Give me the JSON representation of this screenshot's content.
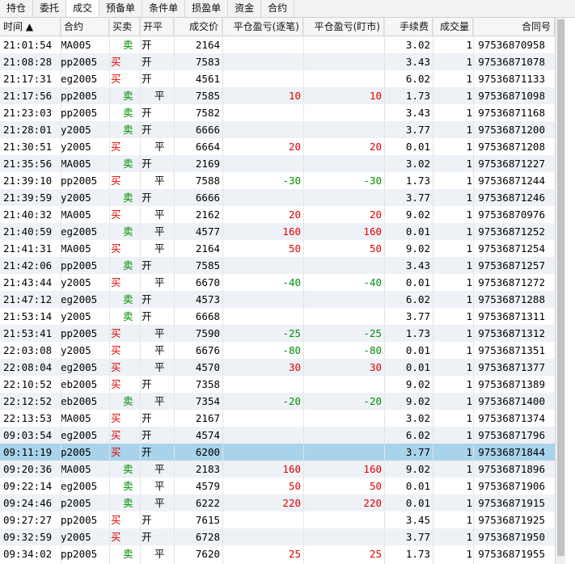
{
  "tabs": [
    "持仓",
    "委托",
    "成交",
    "预备单",
    "条件单",
    "损盈单",
    "资金",
    "合约"
  ],
  "active_tab": "成交",
  "columns": [
    "时间 ▲",
    "合约",
    "买卖",
    "开平",
    "成交价",
    "平仓盈亏(逐笔)",
    "平仓盈亏(盯市)",
    "手续费",
    "成交量",
    "合同号"
  ],
  "colors": {
    "buy": "#e00000",
    "sell": "#009000",
    "selected": "#a9d3ea"
  },
  "rows": [
    {
      "time": "21:01:54",
      "contract": "MA005",
      "side": "卖",
      "oc": "开",
      "price": "2164",
      "pnl1": "",
      "pnl2": "",
      "fee": "3.02",
      "qty": "1",
      "order": "97536870958"
    },
    {
      "time": "21:08:28",
      "contract": "pp2005",
      "side": "买",
      "oc": "开",
      "price": "7583",
      "pnl1": "",
      "pnl2": "",
      "fee": "3.43",
      "qty": "1",
      "order": "97536871078"
    },
    {
      "time": "21:17:31",
      "contract": "eg2005",
      "side": "买",
      "oc": "开",
      "price": "4561",
      "pnl1": "",
      "pnl2": "",
      "fee": "6.02",
      "qty": "1",
      "order": "97536871133"
    },
    {
      "time": "21:17:56",
      "contract": "pp2005",
      "side": "卖",
      "oc": "平",
      "price": "7585",
      "pnl1": "10",
      "pnl2": "10",
      "fee": "1.73",
      "qty": "1",
      "order": "97536871098"
    },
    {
      "time": "21:23:03",
      "contract": "pp2005",
      "side": "卖",
      "oc": "开",
      "price": "7582",
      "pnl1": "",
      "pnl2": "",
      "fee": "3.43",
      "qty": "1",
      "order": "97536871168"
    },
    {
      "time": "21:28:01",
      "contract": "y2005",
      "side": "卖",
      "oc": "开",
      "price": "6666",
      "pnl1": "",
      "pnl2": "",
      "fee": "3.77",
      "qty": "1",
      "order": "97536871200"
    },
    {
      "time": "21:30:51",
      "contract": "y2005",
      "side": "买",
      "oc": "平",
      "price": "6664",
      "pnl1": "20",
      "pnl2": "20",
      "fee": "0.01",
      "qty": "1",
      "order": "97536871208"
    },
    {
      "time": "21:35:56",
      "contract": "MA005",
      "side": "卖",
      "oc": "开",
      "price": "2169",
      "pnl1": "",
      "pnl2": "",
      "fee": "3.02",
      "qty": "1",
      "order": "97536871227"
    },
    {
      "time": "21:39:10",
      "contract": "pp2005",
      "side": "买",
      "oc": "平",
      "price": "7588",
      "pnl1": "-30",
      "pnl2": "-30",
      "fee": "1.73",
      "qty": "1",
      "order": "97536871244"
    },
    {
      "time": "21:39:59",
      "contract": "y2005",
      "side": "卖",
      "oc": "开",
      "price": "6666",
      "pnl1": "",
      "pnl2": "",
      "fee": "3.77",
      "qty": "1",
      "order": "97536871246"
    },
    {
      "time": "21:40:32",
      "contract": "MA005",
      "side": "买",
      "oc": "平",
      "price": "2162",
      "pnl1": "20",
      "pnl2": "20",
      "fee": "9.02",
      "qty": "1",
      "order": "97536870976"
    },
    {
      "time": "21:40:59",
      "contract": "eg2005",
      "side": "卖",
      "oc": "平",
      "price": "4577",
      "pnl1": "160",
      "pnl2": "160",
      "fee": "0.01",
      "qty": "1",
      "order": "97536871252"
    },
    {
      "time": "21:41:31",
      "contract": "MA005",
      "side": "买",
      "oc": "平",
      "price": "2164",
      "pnl1": "50",
      "pnl2": "50",
      "fee": "9.02",
      "qty": "1",
      "order": "97536871254"
    },
    {
      "time": "21:42:06",
      "contract": "pp2005",
      "side": "卖",
      "oc": "开",
      "price": "7585",
      "pnl1": "",
      "pnl2": "",
      "fee": "3.43",
      "qty": "1",
      "order": "97536871257"
    },
    {
      "time": "21:43:44",
      "contract": "y2005",
      "side": "买",
      "oc": "平",
      "price": "6670",
      "pnl1": "-40",
      "pnl2": "-40",
      "fee": "0.01",
      "qty": "1",
      "order": "97536871272"
    },
    {
      "time": "21:47:12",
      "contract": "eg2005",
      "side": "卖",
      "oc": "开",
      "price": "4573",
      "pnl1": "",
      "pnl2": "",
      "fee": "6.02",
      "qty": "1",
      "order": "97536871288"
    },
    {
      "time": "21:53:14",
      "contract": "y2005",
      "side": "卖",
      "oc": "开",
      "price": "6668",
      "pnl1": "",
      "pnl2": "",
      "fee": "3.77",
      "qty": "1",
      "order": "97536871311"
    },
    {
      "time": "21:53:41",
      "contract": "pp2005",
      "side": "买",
      "oc": "平",
      "price": "7590",
      "pnl1": "-25",
      "pnl2": "-25",
      "fee": "1.73",
      "qty": "1",
      "order": "97536871312"
    },
    {
      "time": "22:03:08",
      "contract": "y2005",
      "side": "买",
      "oc": "平",
      "price": "6676",
      "pnl1": "-80",
      "pnl2": "-80",
      "fee": "0.01",
      "qty": "1",
      "order": "97536871351"
    },
    {
      "time": "22:08:04",
      "contract": "eg2005",
      "side": "买",
      "oc": "平",
      "price": "4570",
      "pnl1": "30",
      "pnl2": "30",
      "fee": "0.01",
      "qty": "1",
      "order": "97536871377"
    },
    {
      "time": "22:10:52",
      "contract": "eb2005",
      "side": "买",
      "oc": "开",
      "price": "7358",
      "pnl1": "",
      "pnl2": "",
      "fee": "9.02",
      "qty": "1",
      "order": "97536871389"
    },
    {
      "time": "22:12:52",
      "contract": "eb2005",
      "side": "卖",
      "oc": "平",
      "price": "7354",
      "pnl1": "-20",
      "pnl2": "-20",
      "fee": "9.02",
      "qty": "1",
      "order": "97536871400"
    },
    {
      "time": "22:13:53",
      "contract": "MA005",
      "side": "买",
      "oc": "开",
      "price": "2167",
      "pnl1": "",
      "pnl2": "",
      "fee": "3.02",
      "qty": "1",
      "order": "97536871374"
    },
    {
      "time": "09:03:54",
      "contract": "eg2005",
      "side": "买",
      "oc": "开",
      "price": "4574",
      "pnl1": "",
      "pnl2": "",
      "fee": "6.02",
      "qty": "1",
      "order": "97536871796"
    },
    {
      "time": "09:11:19",
      "contract": "p2005",
      "side": "买",
      "oc": "开",
      "price": "6200",
      "pnl1": "",
      "pnl2": "",
      "fee": "3.77",
      "qty": "1",
      "order": "97536871844",
      "selected": true
    },
    {
      "time": "09:20:36",
      "contract": "MA005",
      "side": "卖",
      "oc": "平",
      "price": "2183",
      "pnl1": "160",
      "pnl2": "160",
      "fee": "9.02",
      "qty": "1",
      "order": "97536871896"
    },
    {
      "time": "09:22:14",
      "contract": "eg2005",
      "side": "卖",
      "oc": "平",
      "price": "4579",
      "pnl1": "50",
      "pnl2": "50",
      "fee": "0.01",
      "qty": "1",
      "order": "97536871906"
    },
    {
      "time": "09:24:46",
      "contract": "p2005",
      "side": "卖",
      "oc": "平",
      "price": "6222",
      "pnl1": "220",
      "pnl2": "220",
      "fee": "0.01",
      "qty": "1",
      "order": "97536871915"
    },
    {
      "time": "09:27:27",
      "contract": "pp2005",
      "side": "买",
      "oc": "开",
      "price": "7615",
      "pnl1": "",
      "pnl2": "",
      "fee": "3.45",
      "qty": "1",
      "order": "97536871925"
    },
    {
      "time": "09:32:59",
      "contract": "y2005",
      "side": "买",
      "oc": "开",
      "price": "6728",
      "pnl1": "",
      "pnl2": "",
      "fee": "3.77",
      "qty": "1",
      "order": "97536871950"
    },
    {
      "time": "09:34:02",
      "contract": "pp2005",
      "side": "卖",
      "oc": "平",
      "price": "7620",
      "pnl1": "25",
      "pnl2": "25",
      "fee": "1.73",
      "qty": "1",
      "order": "97536871955"
    }
  ]
}
